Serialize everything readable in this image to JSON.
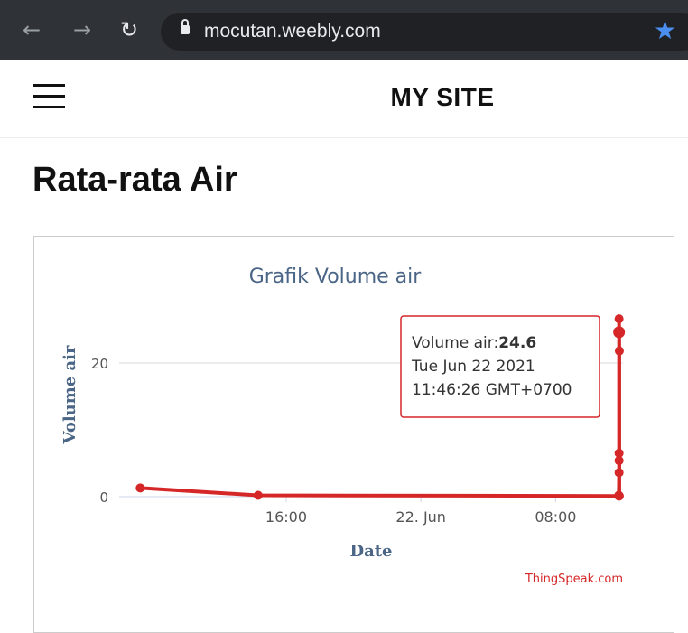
{
  "browser": {
    "url": "mocutan.weebly.com",
    "back_icon": "arrow-left-icon",
    "forward_icon": "arrow-right-icon",
    "reload_icon": "reload-icon",
    "lock_icon": "lock-icon",
    "bookmark_icon": "star-icon",
    "bookmark_color": "#4a8ff0"
  },
  "site": {
    "menu_icon": "hamburger-menu-icon",
    "title": "MY SITE"
  },
  "page": {
    "heading": "Rata-rata Air"
  },
  "chart_data": {
    "type": "line",
    "title": "Grafik Volume air",
    "xlabel": "Date",
    "ylabel": "Volume air",
    "x_ticks": [
      "16:00",
      "22. Jun",
      "08:00"
    ],
    "y_ticks": [
      0,
      20
    ],
    "series": [
      {
        "name": "Volume air",
        "color": "#d62728",
        "points": [
          {
            "x": "2021-06-21 07:20",
            "y": 1.3
          },
          {
            "x": "2021-06-21 14:20",
            "y": 0.2
          },
          {
            "x": "2021-06-22 11:45",
            "y": 0.1
          },
          {
            "x": "2021-06-22 11:45",
            "y": 0.2
          },
          {
            "x": "2021-06-22 11:46",
            "y": 3.6
          },
          {
            "x": "2021-06-22 11:46",
            "y": 5.4
          },
          {
            "x": "2021-06-22 11:46",
            "y": 6.5
          },
          {
            "x": "2021-06-22 11:46",
            "y": 24.6
          },
          {
            "x": "2021-06-22 11:46",
            "y": 26.6
          },
          {
            "x": "2021-06-22 11:47",
            "y": 21.8
          },
          {
            "x": "2021-06-22 11:47",
            "y": 0.1
          }
        ]
      }
    ],
    "tooltip": {
      "series_label": "Volume air:",
      "value": "24.6",
      "date": "Tue Jun 22 2021",
      "time": "11:46:26 GMT+0700"
    },
    "credit": "ThingSpeak.com"
  }
}
